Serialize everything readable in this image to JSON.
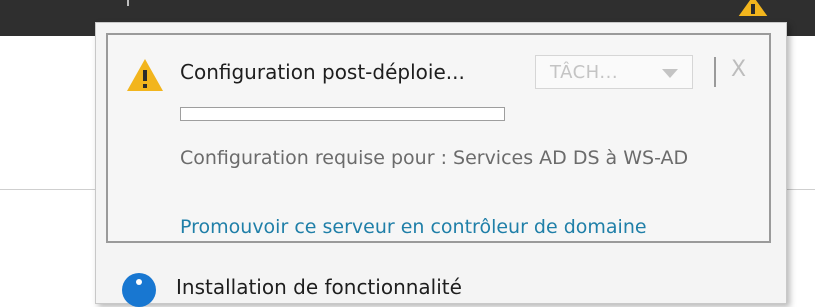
{
  "top_bar": {
    "flag_icon": "warning-triangle-icon"
  },
  "notification": {
    "icon": "warning-triangle-icon",
    "title": "Configuration post-déploie...",
    "task_dropdown_label": "TÂCH...",
    "close_label": "X",
    "progress": 0,
    "description": "Configuration requise pour : Services AD DS à WS-AD",
    "action_link": "Promouvoir ce serveur en contrôleur de domaine"
  },
  "second_notification": {
    "icon": "info-icon",
    "title": "Installation de fonctionnalité"
  },
  "colors": {
    "warning": "#f2b51d",
    "link": "#1f7fa8",
    "info": "#1877d1",
    "progress": "#3aa13a"
  }
}
